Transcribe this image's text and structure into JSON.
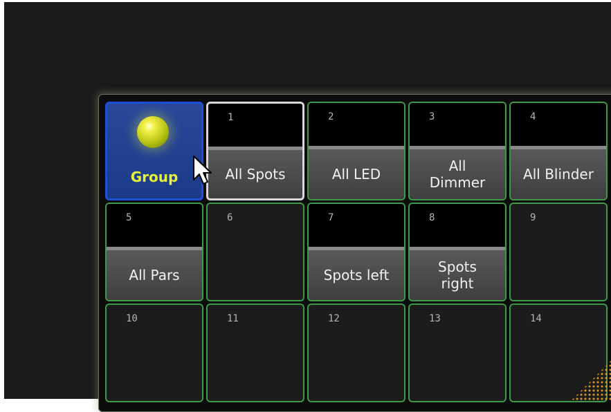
{
  "group_button": {
    "label": "Group",
    "icon": "light-bulb-icon",
    "accent": "#e5f23a",
    "border": "#1f4fd6"
  },
  "colors": {
    "tile_border": "#3e9a47",
    "selected_border": "#d9d9d9",
    "background": "#1a1a1a",
    "corner_dots": "#d89a1e"
  },
  "tiles": [
    {
      "number": "1",
      "label": "All Spots",
      "stored": true,
      "selected": true
    },
    {
      "number": "2",
      "label": "All LED",
      "stored": true,
      "selected": false
    },
    {
      "number": "3",
      "label": "All Dimmer",
      "stored": true,
      "selected": false
    },
    {
      "number": "4",
      "label": "All Blinder",
      "stored": true,
      "selected": false
    },
    {
      "number": "5",
      "label": "All Pars",
      "stored": true,
      "selected": false
    },
    {
      "number": "6",
      "label": "",
      "stored": false,
      "selected": false
    },
    {
      "number": "7",
      "label": "Spots left",
      "stored": true,
      "selected": false
    },
    {
      "number": "8",
      "label": "Spots right",
      "stored": true,
      "selected": false
    },
    {
      "number": "9",
      "label": "",
      "stored": false,
      "selected": false
    },
    {
      "number": "10",
      "label": "",
      "stored": false,
      "selected": false
    },
    {
      "number": "11",
      "label": "",
      "stored": false,
      "selected": false
    },
    {
      "number": "12",
      "label": "",
      "stored": false,
      "selected": false
    },
    {
      "number": "13",
      "label": "",
      "stored": false,
      "selected": false
    },
    {
      "number": "14",
      "label": "",
      "stored": false,
      "selected": false
    }
  ]
}
